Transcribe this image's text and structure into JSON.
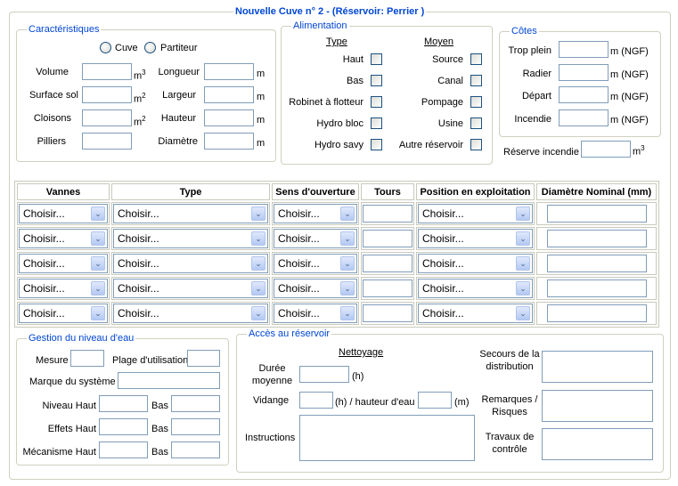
{
  "title": "Nouvelle Cuve n° 2 - (Réservoir: Perrier )",
  "caracteristiques": {
    "legend": "Caractéristiques",
    "radio_cuve": "Cuve",
    "radio_partiteur": "Partiteur",
    "volume": "Volume",
    "surface": "Surface sol",
    "cloisons": "Cloisons",
    "pilliers": "Pilliers",
    "longueur": "Longueur",
    "largeur": "Largeur",
    "hauteur": "Hauteur",
    "diametre": "Diamètre",
    "unit_m": "m",
    "unit_m3": "m",
    "sup3": "3",
    "sup2": "2"
  },
  "alimentation": {
    "legend": "Alimentation",
    "type_header": "Type",
    "moyen_header": "Moyen",
    "types": [
      "Haut",
      "Bas",
      "Robinet à flotteur",
      "Hydro bloc",
      "Hydro savy"
    ],
    "moyens": [
      "Source",
      "Canal",
      "Pompage",
      "Usine",
      "Autre réservoir"
    ]
  },
  "cotes": {
    "legend": "Côtes",
    "items": [
      "Trop plein",
      "Radier",
      "Départ",
      "Incendie"
    ],
    "unit": "m (NGF)"
  },
  "reserve": {
    "label": "Réserve incendie",
    "unit": "m",
    "sup": "3"
  },
  "table": {
    "headers": [
      "Vannes",
      "Type",
      "Sens d'ouverture",
      "Tours",
      "Position en exploitation",
      "Diamètre Nominal (mm)"
    ],
    "placeholder": "Choisir...",
    "row_count": 5
  },
  "gestion": {
    "legend": "Gestion du niveau d'eau",
    "mesure": "Mesure",
    "plage": "Plage d'utilisation",
    "marque": "Marque du système",
    "niveau": "Niveau Haut",
    "effets": "Effets Haut",
    "mecanisme": "Mécanisme Haut",
    "bas": "Bas"
  },
  "acces": {
    "legend": "Accès au réservoir",
    "nettoyage": "Nettoyage",
    "duree": "Durée moyenne",
    "h": "(h)",
    "vidange": "Vidange",
    "hauteur": "(h) / hauteur d'eau",
    "m": "(m)",
    "instructions": "Instructions",
    "secours": "Secours de la distribution",
    "remarques": "Remarques / Risques",
    "travaux": "Travaux de contrôle"
  }
}
